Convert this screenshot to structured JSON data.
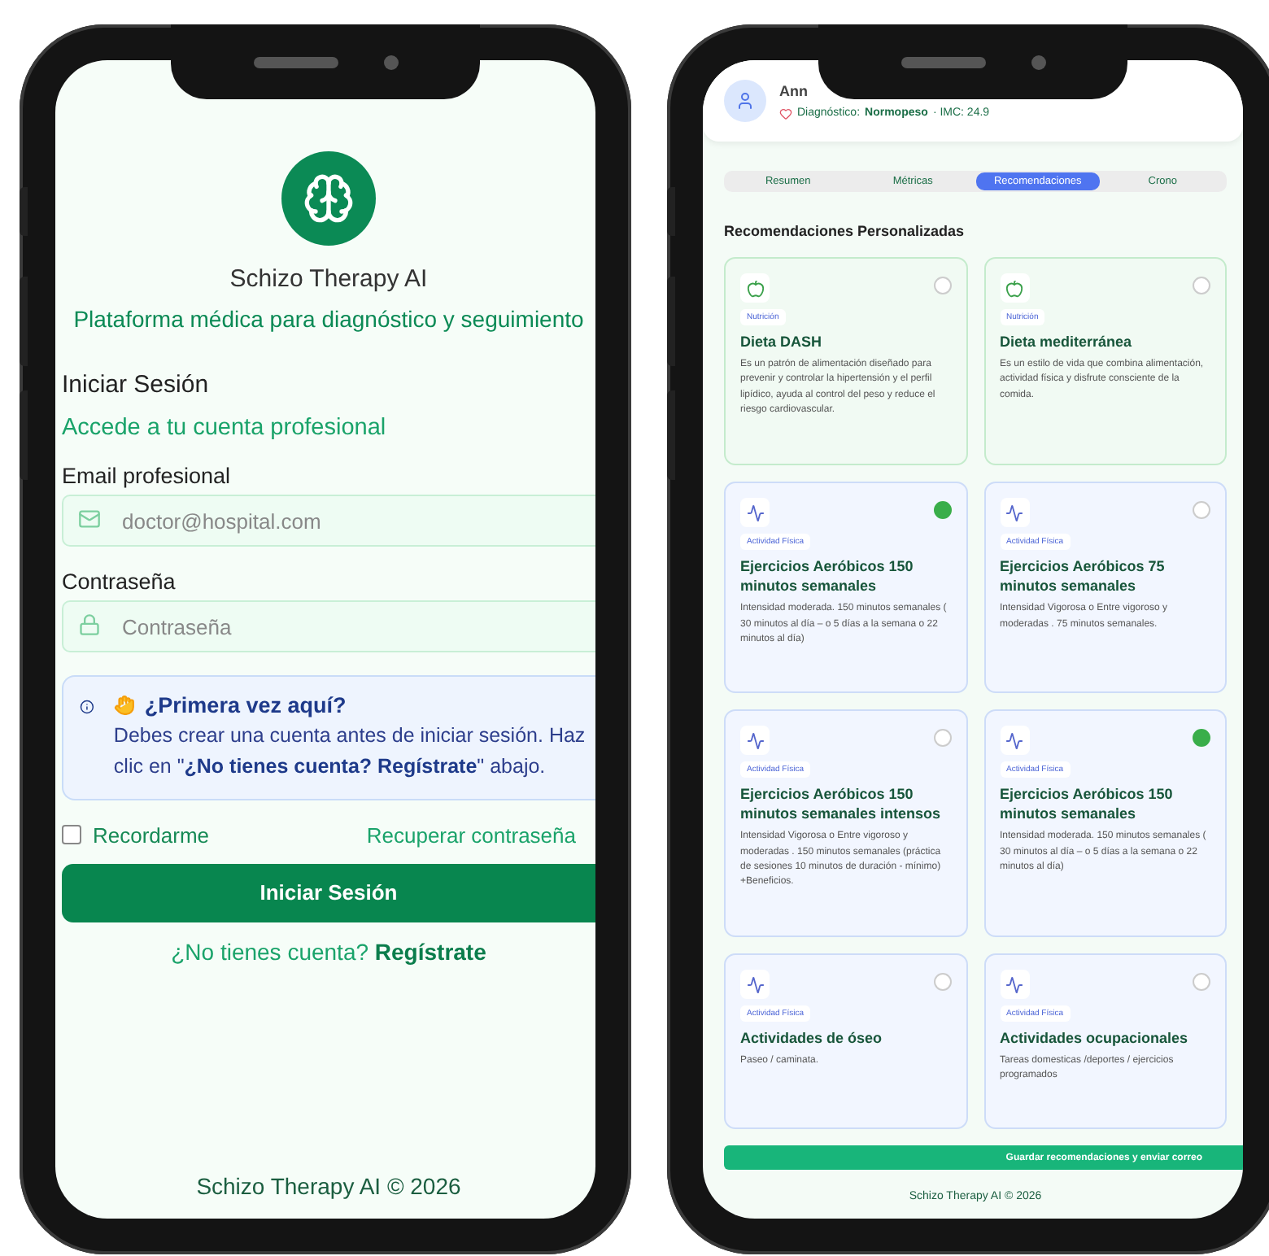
{
  "login_screen": {
    "app_name": "Schizo Therapy AI",
    "subtitle": "Plataforma médica para diagnóstico y seguimiento",
    "heading": "Iniciar Sesión",
    "subheading": "Accede a tu cuenta profesional",
    "fields": [
      {
        "label": "Email profesional",
        "placeholder": "doctor@hospital.com",
        "kind": "email"
      },
      {
        "label": "Contraseña",
        "placeholder": "Contraseña",
        "kind": "password"
      }
    ],
    "notice": {
      "title": "¿Primera vez aquí?",
      "text": "Debes crear una cuenta antes de iniciar sesión. Haz clic en \"**¿No tienes cuenta? Regístrate**\" abajo."
    },
    "remember": {
      "label": "Recordarme",
      "checked": false
    },
    "forgot_link": "Recuperar contraseña",
    "submit_button": "Iniciar Sesión",
    "register_prompt": "¿No tienes cuenta?",
    "register_link": "Regístrate",
    "footer": "Schizo Therapy AI © 2026"
  },
  "recommendations_screen": {
    "patient": {
      "name": "Ann",
      "diagnosis_label": "Diagnóstico:",
      "diagnosis": "Normopeso",
      "bmi": "· IMC: 24.9"
    },
    "tabs": [
      {
        "label": "Resumen",
        "selected": false
      },
      {
        "label": "Métricas",
        "selected": false
      },
      {
        "label": "Recomendaciones",
        "selected": true
      },
      {
        "label": "Crono",
        "selected": false
      }
    ],
    "heading": "Recomendaciones Personalizadas",
    "cards": [
      {
        "kind": "nutrition",
        "tag": "Nutrición",
        "title": "Dieta DASH",
        "text": "Es un patrón de alimentación diseñado para prevenir y controlar la hipertensión y el perfil lipídico, ayuda al control del peso y reduce el riesgo cardiovascular.",
        "selected": false
      },
      {
        "kind": "nutrition",
        "tag": "Nutrición",
        "title": "Dieta mediterránea",
        "text": "Es un estilo de vida que combina alimentación, actividad física y disfrute consciente de la comida.",
        "selected": false
      },
      {
        "kind": "activity",
        "tag": "Actividad Física",
        "title": "Ejercicios Aeróbicos 150 minutos semanales",
        "text": "Intensidad moderada. 150 minutos semanales ( 30 minutos al día – o 5 días a la semana o 22 minutos al día)",
        "selected": true
      },
      {
        "kind": "activity",
        "tag": "Actividad Física",
        "title": "Ejercicios Aeróbicos 75 minutos semanales",
        "text": "Intensidad Vigorosa o Entre vigoroso y moderadas . 75 minutos semanales.",
        "selected": false
      },
      {
        "kind": "activity",
        "tag": "Actividad Física",
        "title": "Ejercicios Aeróbicos 150 minutos semanales intensos",
        "text": "Intensidad Vigorosa o Entre vigoroso y moderadas . 150 minutos semanales (práctica de sesiones 10 minutos de duración - mínimo) +Beneficios.",
        "selected": false
      },
      {
        "kind": "activity",
        "tag": "Actividad Física",
        "title": "Ejercicios Aeróbicos 150 minutos semanales",
        "text": "Intensidad moderada. 150 minutos semanales ( 30 minutos al día – o 5 días a la semana o 22 minutos al día)",
        "selected": true
      },
      {
        "kind": "activity",
        "tag": "Actividad Física",
        "title": "Actividades de óseo",
        "text": "Paseo / caminata.",
        "selected": false
      },
      {
        "kind": "activity",
        "tag": "Actividad Física",
        "title": "Actividades ocupacionales",
        "text": "Tareas domesticas /deportes / ejercicios programados",
        "selected": false
      }
    ],
    "save_button": "Guardar recomendaciones y enviar correo",
    "footer": "Schizo Therapy AI © 2026"
  }
}
